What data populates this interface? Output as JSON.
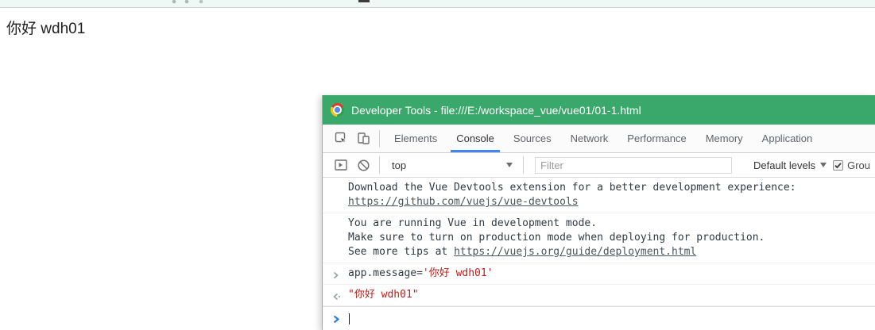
{
  "page": {
    "heading": "你好 wdh01"
  },
  "devtools": {
    "title": "Developer Tools - file:///E:/workspace_vue/vue01/01-1.html",
    "tabs": [
      {
        "label": "Elements",
        "active": false
      },
      {
        "label": "Console",
        "active": true
      },
      {
        "label": "Sources",
        "active": false
      },
      {
        "label": "Network",
        "active": false
      },
      {
        "label": "Performance",
        "active": false
      },
      {
        "label": "Memory",
        "active": false
      },
      {
        "label": "Application",
        "active": false
      }
    ],
    "toolbar": {
      "context": "top",
      "filter_placeholder": "Filter",
      "levels_label": "Default levels",
      "group_label": "Grou",
      "group_checked": true
    },
    "console": {
      "vue_devtools_msg": {
        "line1": "Download the Vue Devtools extension for a better development experience:",
        "link": "https://github.com/vuejs/vue-devtools"
      },
      "vue_mode_msg": {
        "line1": "You are running Vue in development mode.",
        "line2": "Make sure to turn on production mode when deploying for production.",
        "line3_prefix": "See more tips at ",
        "link": "https://vuejs.org/guide/deployment.html"
      },
      "command": {
        "code": "app.message=",
        "string": "'你好 wdh01'"
      },
      "result": "\"你好 wdh01\""
    },
    "icons": {
      "titlebar": "chrome-logo-icon",
      "tabbar": [
        "inspect-element-icon",
        "device-toolbar-icon"
      ],
      "console_toolbar": [
        "console-sidebar-icon",
        "clear-console-icon",
        "chevron-down-icon"
      ]
    },
    "colors": {
      "titlebar_green": "#3aa76b",
      "tab_underline_blue": "#4285f4",
      "string_red": "#c41a16",
      "prompt_blue": "#2f7df4",
      "link_gray": "#4c555c"
    }
  }
}
